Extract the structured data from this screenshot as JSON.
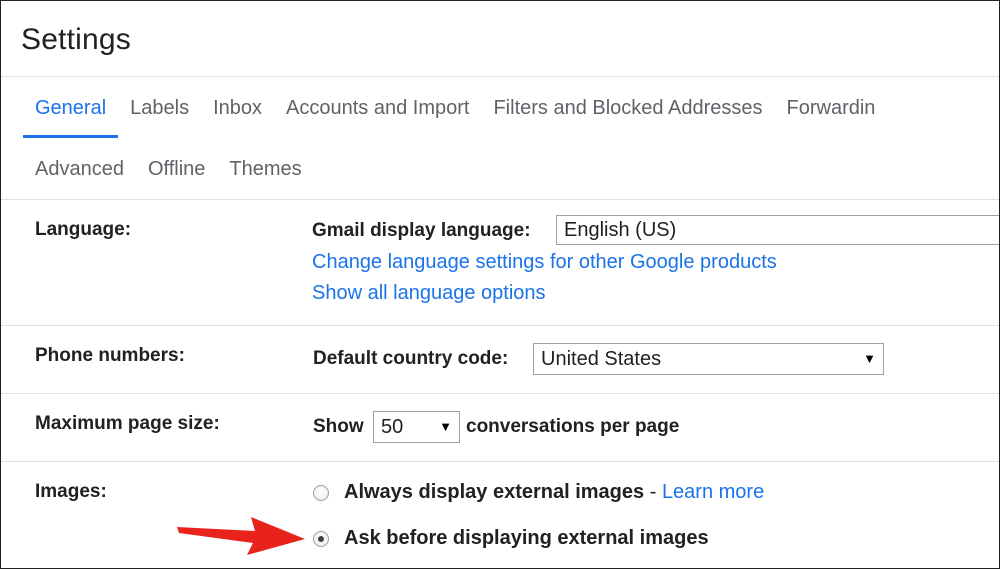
{
  "page": {
    "title": "Settings"
  },
  "tabs": {
    "row1": [
      {
        "label": "General",
        "active": true
      },
      {
        "label": "Labels"
      },
      {
        "label": "Inbox"
      },
      {
        "label": "Accounts and Import"
      },
      {
        "label": "Filters and Blocked Addresses"
      },
      {
        "label": "Forwardin"
      }
    ],
    "row2": [
      {
        "label": "Advanced"
      },
      {
        "label": "Offline"
      },
      {
        "label": "Themes"
      }
    ]
  },
  "language": {
    "label": "Language:",
    "display_language_label": "Gmail display language:",
    "display_language_value": "English (US)",
    "change_link": "Change language settings for other Google products",
    "show_all_link": "Show all language options"
  },
  "phone": {
    "label": "Phone numbers:",
    "country_code_label": "Default country code:",
    "country_code_value": "United States"
  },
  "page_size": {
    "label": "Maximum page size:",
    "show_label": "Show",
    "value": "50",
    "suffix": "conversations per page"
  },
  "images": {
    "label": "Images:",
    "option_always": "Always display external images",
    "separator": " - ",
    "learn_more": "Learn more",
    "option_ask": "Ask before displaying external images",
    "selected": "ask"
  },
  "icons": {
    "caret": "caret-down-icon",
    "annotation_arrow": "red-arrow-icon"
  },
  "colors": {
    "accent": "#1a73e8",
    "arrow": "#e8231c"
  }
}
